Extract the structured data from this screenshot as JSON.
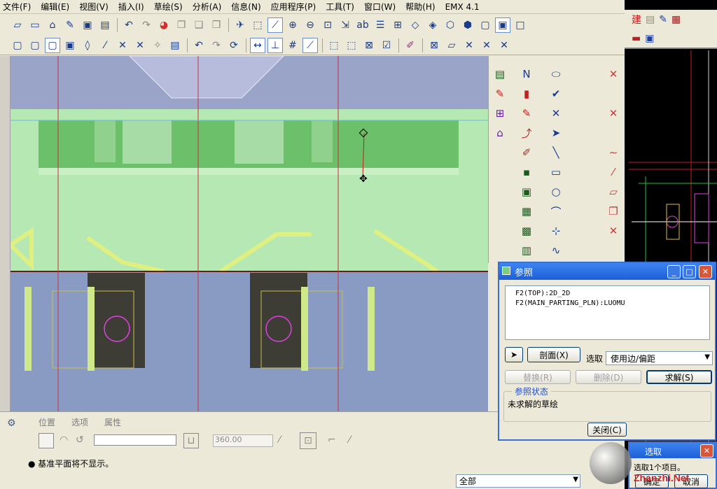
{
  "menu": [
    "文件(F)",
    "编辑(E)",
    "视图(V)",
    "插入(I)",
    "草绘(S)",
    "分析(A)",
    "信息(N)",
    "应用程序(P)",
    "工具(T)",
    "窗口(W)",
    "帮助(H)",
    "EMX 4.1"
  ],
  "toolbar1_icons": [
    "new-icon",
    "open-icon",
    "brush-icon",
    "save-icon",
    "print-icon",
    "undo-icon",
    "redo-icon",
    "color-wheel-icon",
    "copy-icon",
    "paste-icon",
    "paste-special-icon",
    "regen-icon",
    "repaint-icon",
    "sketch-icon",
    "zoom-in-icon",
    "zoom-out-icon",
    "refit-icon",
    "orient-icon",
    "rename-icon",
    "layers-icon",
    "view-manager-icon",
    "datum-plane-icon",
    "datum-axis-icon",
    "datum-point-icon",
    "csys-icon",
    "shade-icon"
  ],
  "toolbar2_icons": [
    "wireframe-icon",
    "hidden-line-icon",
    "no-hidden-icon",
    "shading-icon",
    "plane-display-icon",
    "axis-display-icon",
    "point-display-icon",
    "csys-display-icon",
    "spin-center-icon",
    "annotation-icon",
    "undo-icon",
    "redo-icon",
    "regen-icon",
    "dimension-icon",
    "constraint-icon",
    "grid-icon",
    "sketch-view-icon",
    "select-icon",
    "select-all-icon",
    "select-box-icon",
    "check-icon",
    "palette-icon",
    "close-icon",
    "edit-icon",
    "trim-icon",
    "delete-icon"
  ],
  "bottom_panel": {
    "tabs": [
      "位置",
      "选项",
      "属性"
    ],
    "angle_value": "360.00",
    "message": "● 基准平面将不显示。",
    "filter_value": "全部"
  },
  "reference_dialog": {
    "title": "参照",
    "references": [
      "F2(TOP):2D_2D",
      "F2(MAIN_PARTING_PLN):LUOMU"
    ],
    "section_button": "剖面(X)",
    "select_label": "选取",
    "select_value": "使用边/偏距",
    "replace_button": "替换(R)",
    "delete_button": "删除(D)",
    "solve_button": "求解(S)",
    "status_title": "参照状态",
    "status_text": "未求解的草绘",
    "close_button": "关闭(C)"
  },
  "select_box": {
    "title": "选取",
    "prompt": "选取1个项目。",
    "ok_button": "确定",
    "cancel_button": "取消"
  },
  "right_toolbar": [
    "建",
    "▤",
    "✎",
    "▦",
    "▬",
    "▣"
  ],
  "watermark": "Zhanzhi.Net",
  "colors": {
    "model_green": "#b5e8b3",
    "model_blue": "#8a9bc3",
    "dark_green": "#6cc06a",
    "highlight_yellow": "#e0f080",
    "dialog_title": "#1d5fd8"
  }
}
